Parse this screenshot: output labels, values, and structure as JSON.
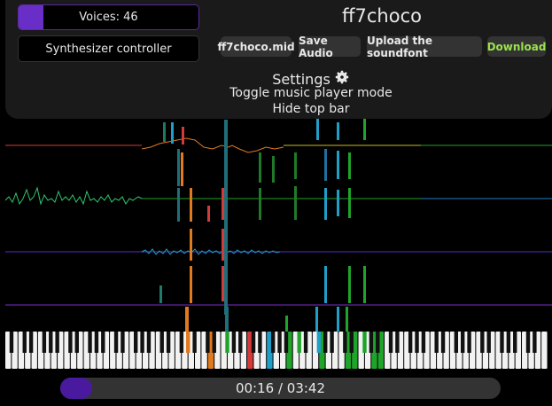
{
  "app": {
    "title": "ff7choco"
  },
  "voices": {
    "label": "Voices: 46",
    "fill_fraction": 0.14
  },
  "synth": {
    "label": "Synthesizer controller"
  },
  "toolbar": {
    "midi_file_label": "ff7choco.mid",
    "save_audio_label": "Save Audio",
    "upload_soundfont_label": "Upload the soundfont",
    "download_label": "Download"
  },
  "settings": {
    "label": "Settings",
    "toggle_player_label": "Toggle music player mode",
    "hide_topbar_label": "Hide top bar"
  },
  "playback": {
    "time_label": "00:16 / 03:42",
    "progress_fraction": 0.072
  },
  "colors": {
    "accent": "#6a2ec8",
    "download": "#99e34a",
    "ch_red": "#d43a3a",
    "ch_orange": "#e07a1f",
    "ch_green": "#1fa32a",
    "ch_teal": "#1f9ec8",
    "ch_purple": "#7a2ec8",
    "ch_yellow": "#c8b81f"
  }
}
